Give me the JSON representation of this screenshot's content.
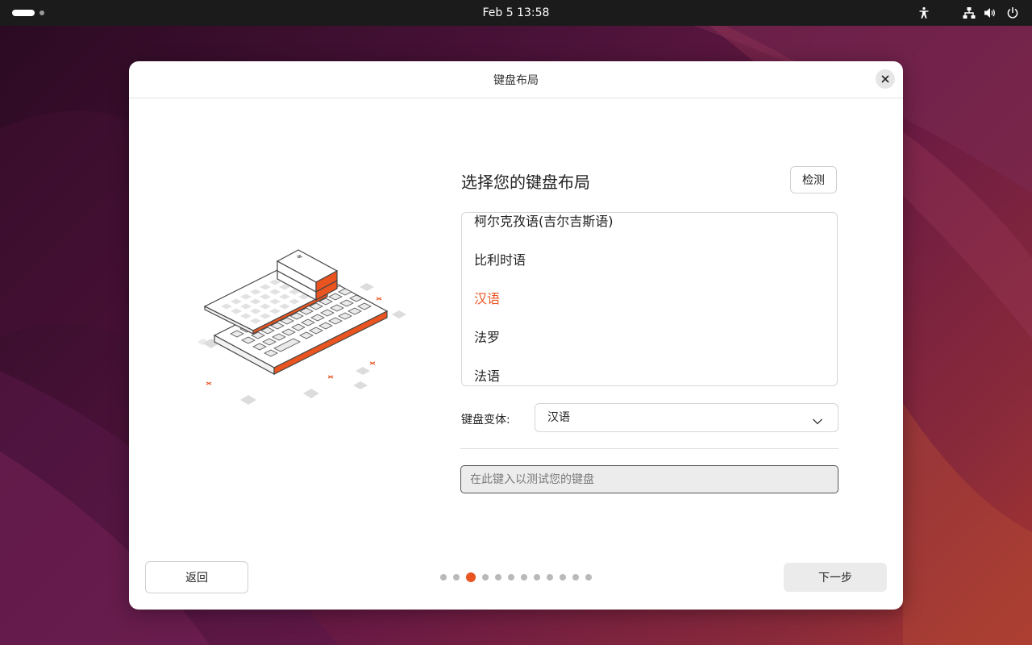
{
  "topbar": {
    "clock": "Feb 5  13:58",
    "icons": [
      "accessibility-icon",
      "network-icon",
      "volume-icon",
      "power-icon"
    ]
  },
  "dialog": {
    "title": "键盘布局",
    "heading": "选择您的键盘布局",
    "detect_label": "检测",
    "layouts": [
      {
        "label": "柯尔克孜语(吉尔吉斯语)",
        "selected": false
      },
      {
        "label": "比利时语",
        "selected": false
      },
      {
        "label": "汉语",
        "selected": true
      },
      {
        "label": "法罗",
        "selected": false
      },
      {
        "label": "法语",
        "selected": false
      }
    ],
    "variant_label": "键盘变体:",
    "variant_value": "汉语",
    "test_placeholder": "在此键入以测试您的键盘",
    "back_label": "返回",
    "next_label": "下一步",
    "progress": {
      "total": 12,
      "current": 3
    }
  },
  "colors": {
    "accent": "#E95420",
    "topbar_bg": "#1b1b1b",
    "dialog_bg": "#ffffff",
    "input_bg": "#ececec"
  }
}
